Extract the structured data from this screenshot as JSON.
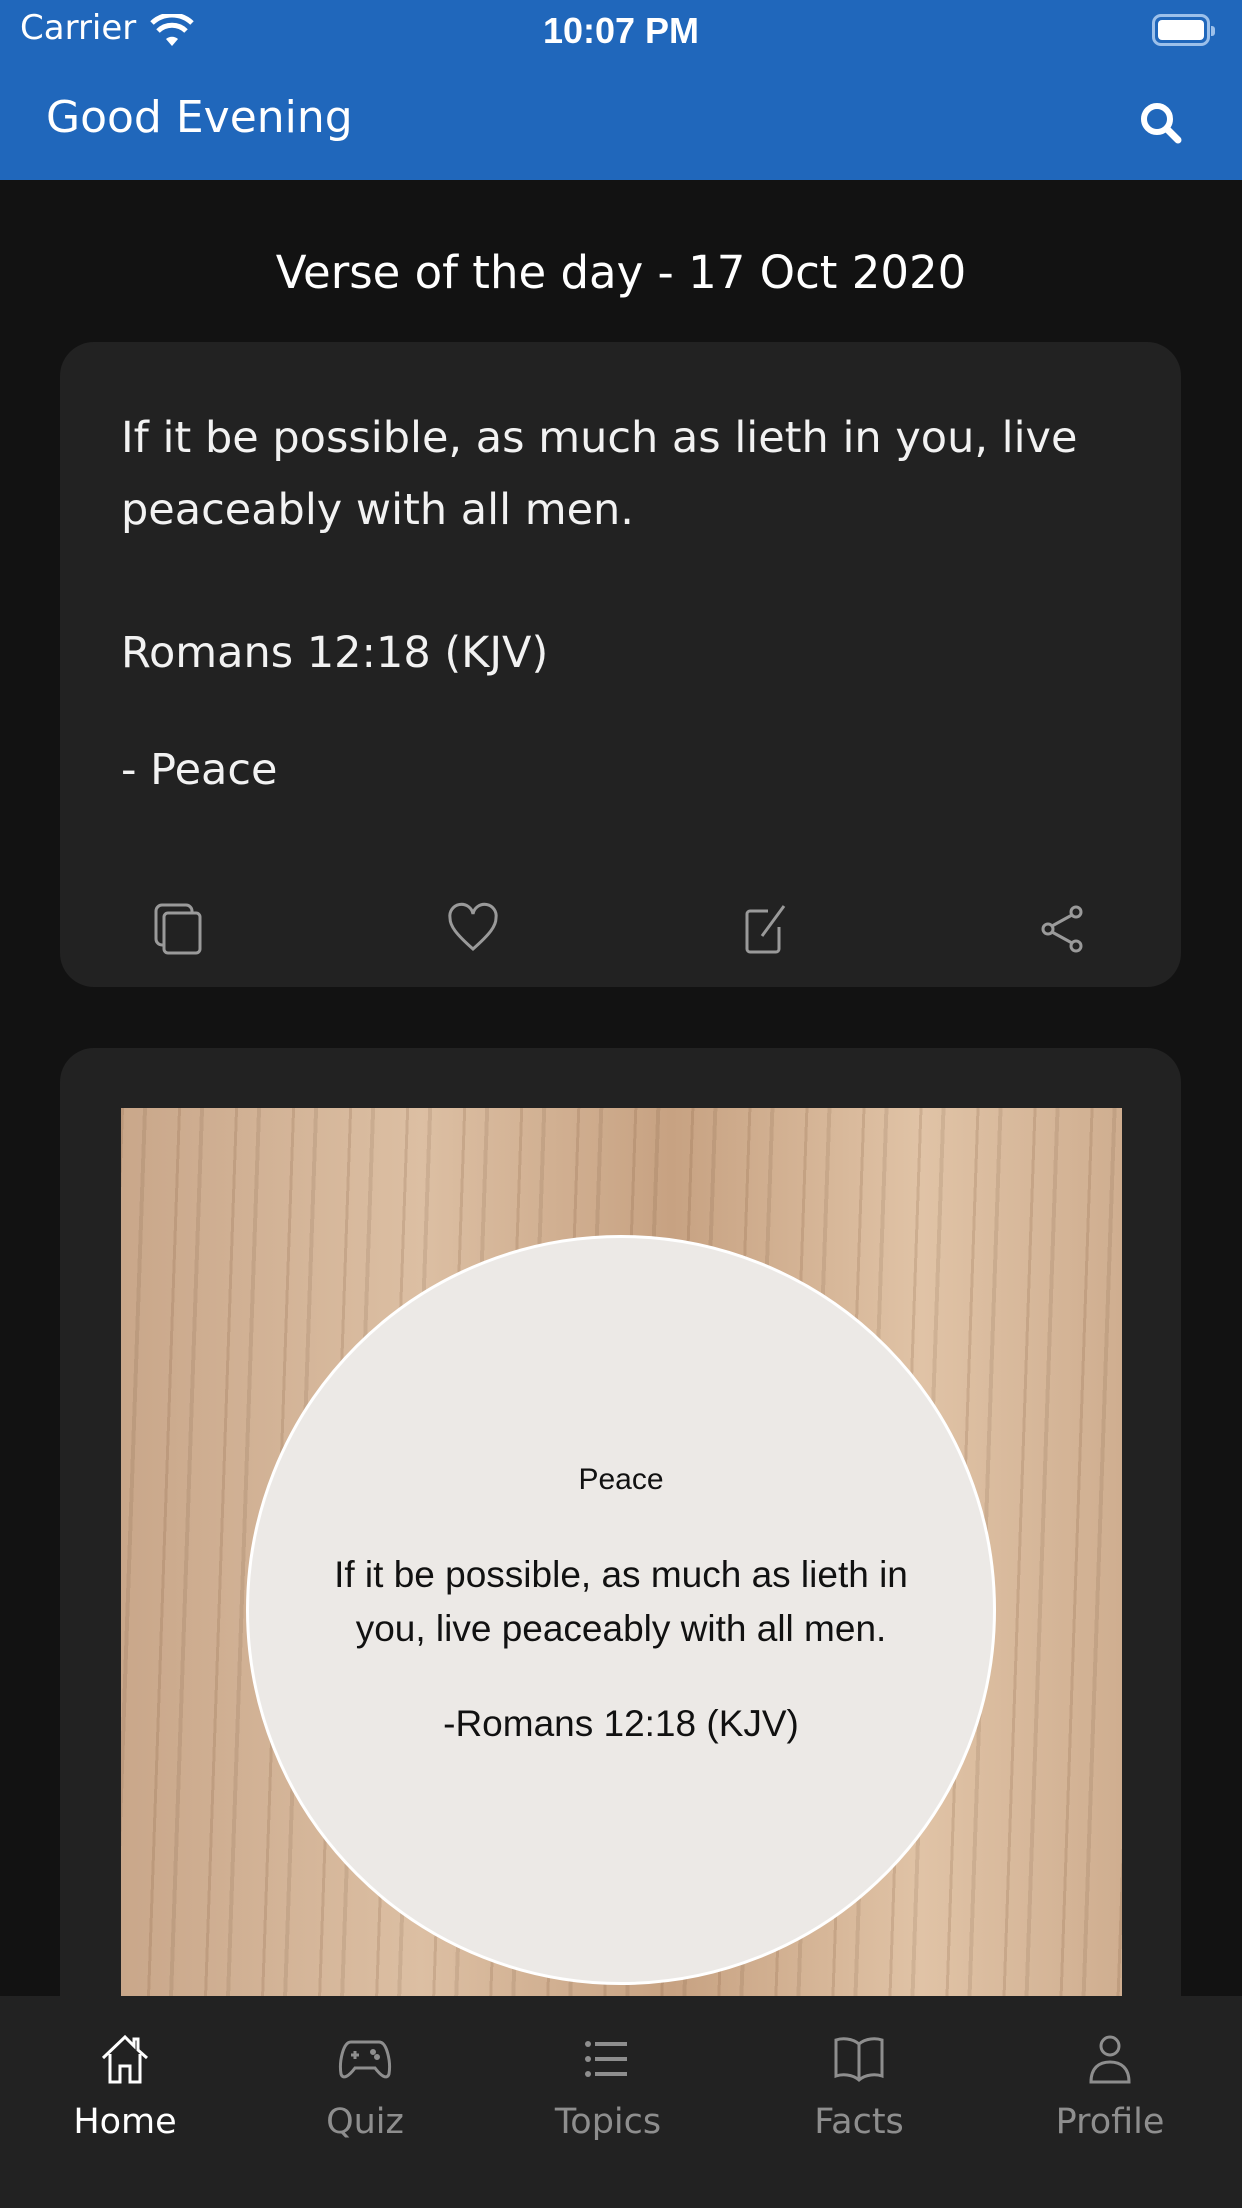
{
  "status_bar": {
    "carrier": "Carrier",
    "time": "10:07 PM"
  },
  "header": {
    "title": "Good Evening",
    "search_icon": "search-icon"
  },
  "colors": {
    "header": "#2067BB",
    "background": "#121212",
    "card": "#222222",
    "tab_active": "#FFFFFF",
    "tab_inactive": "#8E8E8E"
  },
  "verse_of_day": {
    "heading": "Verse of the day - 17 Oct 2020",
    "text": "If it be possible, as much as lieth in you, live peaceably with all men.",
    "reference": "Romans 12:18 (KJV)",
    "topic": "- Peace",
    "actions": [
      "copy-icon",
      "heart-icon",
      "edit-icon",
      "share-icon"
    ]
  },
  "image_card": {
    "title": "Peace",
    "quote": "If it be possible, as much as lieth in you, live peaceably with all men.",
    "reference": "-Romans 12:18 (KJV)"
  },
  "tabs": [
    {
      "label": "Home",
      "icon": "home-icon",
      "active": true
    },
    {
      "label": "Quiz",
      "icon": "gamepad-icon"
    },
    {
      "label": "Topics",
      "icon": "list-icon"
    },
    {
      "label": "Facts",
      "icon": "book-icon"
    },
    {
      "label": "Profile",
      "icon": "person-icon"
    }
  ]
}
